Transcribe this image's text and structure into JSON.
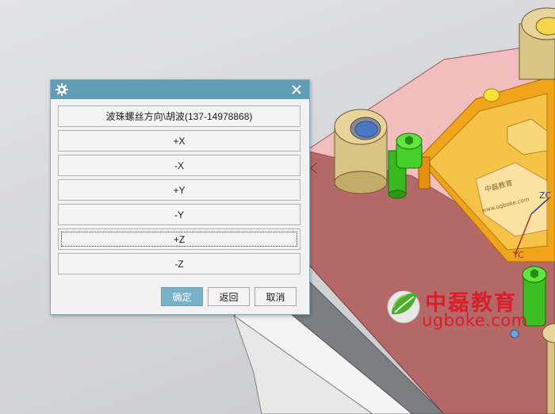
{
  "dialog": {
    "settings_icon": "gear-icon",
    "close_icon": "close-icon",
    "buttons": [
      "波珠螺丝方向\\胡波(137-14978868)",
      "+X",
      "-X",
      "+Y",
      "-Y",
      "+Z",
      "-Z"
    ],
    "focused_button": "+Z",
    "footer": {
      "ok": "确定",
      "back": "返回",
      "cancel": "取消"
    }
  },
  "viewport": {
    "plate_label": "中磊教育",
    "plate_url": "www.ugboke.com",
    "axis_zc": "ZC",
    "axis_yc": "YC"
  },
  "watermark": {
    "brand": "中磊教育",
    "url": "ugboke.com"
  },
  "colors": {
    "titlebar": "#5f9eb5",
    "primary_button": "#79b2c8",
    "mold_base_top": "#f0b8b8",
    "mold_base_side": "#b96a6a",
    "cavity": "#f2a81e",
    "screw": "#3cbf20",
    "bushing": "#d9c080",
    "watermark": "#d6202c"
  }
}
